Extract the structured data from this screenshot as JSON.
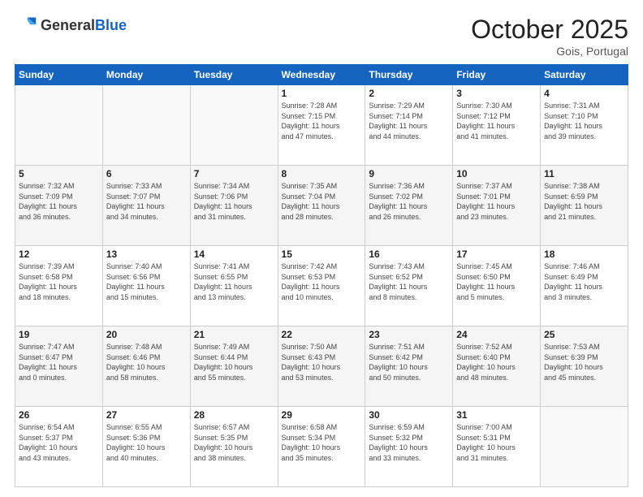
{
  "header": {
    "logo_general": "General",
    "logo_blue": "Blue",
    "month": "October 2025",
    "location": "Gois, Portugal"
  },
  "weekdays": [
    "Sunday",
    "Monday",
    "Tuesday",
    "Wednesday",
    "Thursday",
    "Friday",
    "Saturday"
  ],
  "weeks": [
    [
      {
        "day": "",
        "info": ""
      },
      {
        "day": "",
        "info": ""
      },
      {
        "day": "",
        "info": ""
      },
      {
        "day": "1",
        "info": "Sunrise: 7:28 AM\nSunset: 7:15 PM\nDaylight: 11 hours\nand 47 minutes."
      },
      {
        "day": "2",
        "info": "Sunrise: 7:29 AM\nSunset: 7:14 PM\nDaylight: 11 hours\nand 44 minutes."
      },
      {
        "day": "3",
        "info": "Sunrise: 7:30 AM\nSunset: 7:12 PM\nDaylight: 11 hours\nand 41 minutes."
      },
      {
        "day": "4",
        "info": "Sunrise: 7:31 AM\nSunset: 7:10 PM\nDaylight: 11 hours\nand 39 minutes."
      }
    ],
    [
      {
        "day": "5",
        "info": "Sunrise: 7:32 AM\nSunset: 7:09 PM\nDaylight: 11 hours\nand 36 minutes."
      },
      {
        "day": "6",
        "info": "Sunrise: 7:33 AM\nSunset: 7:07 PM\nDaylight: 11 hours\nand 34 minutes."
      },
      {
        "day": "7",
        "info": "Sunrise: 7:34 AM\nSunset: 7:06 PM\nDaylight: 11 hours\nand 31 minutes."
      },
      {
        "day": "8",
        "info": "Sunrise: 7:35 AM\nSunset: 7:04 PM\nDaylight: 11 hours\nand 28 minutes."
      },
      {
        "day": "9",
        "info": "Sunrise: 7:36 AM\nSunset: 7:02 PM\nDaylight: 11 hours\nand 26 minutes."
      },
      {
        "day": "10",
        "info": "Sunrise: 7:37 AM\nSunset: 7:01 PM\nDaylight: 11 hours\nand 23 minutes."
      },
      {
        "day": "11",
        "info": "Sunrise: 7:38 AM\nSunset: 6:59 PM\nDaylight: 11 hours\nand 21 minutes."
      }
    ],
    [
      {
        "day": "12",
        "info": "Sunrise: 7:39 AM\nSunset: 6:58 PM\nDaylight: 11 hours\nand 18 minutes."
      },
      {
        "day": "13",
        "info": "Sunrise: 7:40 AM\nSunset: 6:56 PM\nDaylight: 11 hours\nand 15 minutes."
      },
      {
        "day": "14",
        "info": "Sunrise: 7:41 AM\nSunset: 6:55 PM\nDaylight: 11 hours\nand 13 minutes."
      },
      {
        "day": "15",
        "info": "Sunrise: 7:42 AM\nSunset: 6:53 PM\nDaylight: 11 hours\nand 10 minutes."
      },
      {
        "day": "16",
        "info": "Sunrise: 7:43 AM\nSunset: 6:52 PM\nDaylight: 11 hours\nand 8 minutes."
      },
      {
        "day": "17",
        "info": "Sunrise: 7:45 AM\nSunset: 6:50 PM\nDaylight: 11 hours\nand 5 minutes."
      },
      {
        "day": "18",
        "info": "Sunrise: 7:46 AM\nSunset: 6:49 PM\nDaylight: 11 hours\nand 3 minutes."
      }
    ],
    [
      {
        "day": "19",
        "info": "Sunrise: 7:47 AM\nSunset: 6:47 PM\nDaylight: 11 hours\nand 0 minutes."
      },
      {
        "day": "20",
        "info": "Sunrise: 7:48 AM\nSunset: 6:46 PM\nDaylight: 10 hours\nand 58 minutes."
      },
      {
        "day": "21",
        "info": "Sunrise: 7:49 AM\nSunset: 6:44 PM\nDaylight: 10 hours\nand 55 minutes."
      },
      {
        "day": "22",
        "info": "Sunrise: 7:50 AM\nSunset: 6:43 PM\nDaylight: 10 hours\nand 53 minutes."
      },
      {
        "day": "23",
        "info": "Sunrise: 7:51 AM\nSunset: 6:42 PM\nDaylight: 10 hours\nand 50 minutes."
      },
      {
        "day": "24",
        "info": "Sunrise: 7:52 AM\nSunset: 6:40 PM\nDaylight: 10 hours\nand 48 minutes."
      },
      {
        "day": "25",
        "info": "Sunrise: 7:53 AM\nSunset: 6:39 PM\nDaylight: 10 hours\nand 45 minutes."
      }
    ],
    [
      {
        "day": "26",
        "info": "Sunrise: 6:54 AM\nSunset: 5:37 PM\nDaylight: 10 hours\nand 43 minutes."
      },
      {
        "day": "27",
        "info": "Sunrise: 6:55 AM\nSunset: 5:36 PM\nDaylight: 10 hours\nand 40 minutes."
      },
      {
        "day": "28",
        "info": "Sunrise: 6:57 AM\nSunset: 5:35 PM\nDaylight: 10 hours\nand 38 minutes."
      },
      {
        "day": "29",
        "info": "Sunrise: 6:58 AM\nSunset: 5:34 PM\nDaylight: 10 hours\nand 35 minutes."
      },
      {
        "day": "30",
        "info": "Sunrise: 6:59 AM\nSunset: 5:32 PM\nDaylight: 10 hours\nand 33 minutes."
      },
      {
        "day": "31",
        "info": "Sunrise: 7:00 AM\nSunset: 5:31 PM\nDaylight: 10 hours\nand 31 minutes."
      },
      {
        "day": "",
        "info": ""
      }
    ]
  ]
}
